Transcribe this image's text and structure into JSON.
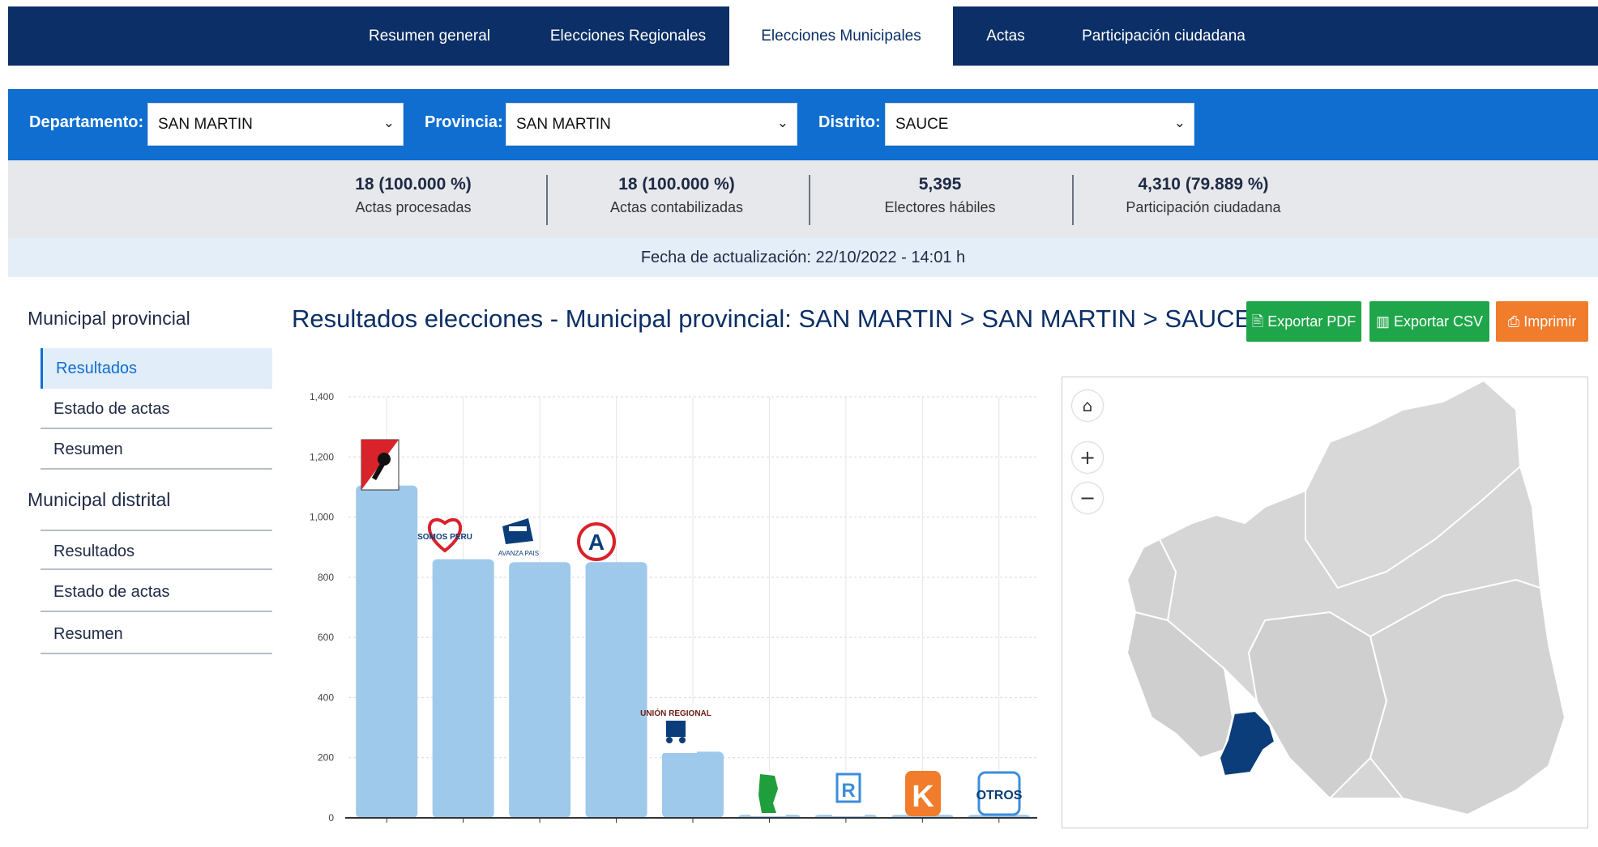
{
  "nav": {
    "tabs": [
      {
        "label": "Resumen general"
      },
      {
        "label": "Elecciones Regionales"
      },
      {
        "label": "Elecciones Municipales"
      },
      {
        "label": "Actas"
      },
      {
        "label": "Participación ciudadana"
      }
    ]
  },
  "filters": {
    "departamento_label": "Departamento:",
    "departamento_value": "SAN MARTIN",
    "provincia_label": "Provincia:",
    "provincia_value": "SAN MARTIN",
    "distrito_label": "Distrito:",
    "distrito_value": "SAUCE",
    "caret": "⌄"
  },
  "stats": [
    {
      "value": "18 (100.000 %)",
      "label": "Actas procesadas"
    },
    {
      "value": "18 (100.000 %)",
      "label": "Actas contabilizadas"
    },
    {
      "value": "5,395",
      "label": "Electores hábiles"
    },
    {
      "value": "4,310 (79.889 %)",
      "label": "Participación ciudadana"
    }
  ],
  "update": {
    "text": "Fecha de actualización: 22/10/2022 - 14:01 h"
  },
  "sidebar": {
    "section1": {
      "title": "Municipal provincial",
      "items": [
        "Resultados",
        "Estado de actas",
        "Resumen"
      ]
    },
    "section2": {
      "title": "Municipal distrital",
      "items": [
        "Resultados",
        "Estado de actas",
        "Resumen"
      ]
    }
  },
  "main": {
    "title": "Resultados elecciones - Municipal provincial: SAN MARTIN > SAN MARTIN > SAUCE"
  },
  "actions": {
    "pdf": "🖹 Exportar PDF",
    "csv": "▥ Exportar CSV",
    "print": "⎙ Imprimir"
  },
  "colors": {
    "bar": "#9fc9eb",
    "pdf": "#1fa64a",
    "csv": "#1fa64a",
    "print": "#f07c2c",
    "map_region": "#d6d6d6",
    "map_selected": "#0b3d7a"
  },
  "map": {
    "home_icon": "home-icon",
    "zoom_in": "+",
    "zoom_out": "−"
  },
  "chart_data": {
    "type": "bar",
    "categories": [
      "",
      "SOMOS PERU",
      "AVANZA PAIS",
      "A",
      "UNIÓN REGIONAL",
      "",
      "R",
      "K",
      "OTROS"
    ],
    "values": [
      1105,
      860,
      850,
      850,
      220,
      10,
      10,
      10,
      10
    ],
    "ylim": [
      0,
      1400
    ],
    "yticks": [
      "0",
      "200",
      "400",
      "600",
      "800",
      "1,000",
      "1,200",
      "1,400"
    ],
    "grid": true,
    "xlabel": "",
    "ylabel": ""
  }
}
